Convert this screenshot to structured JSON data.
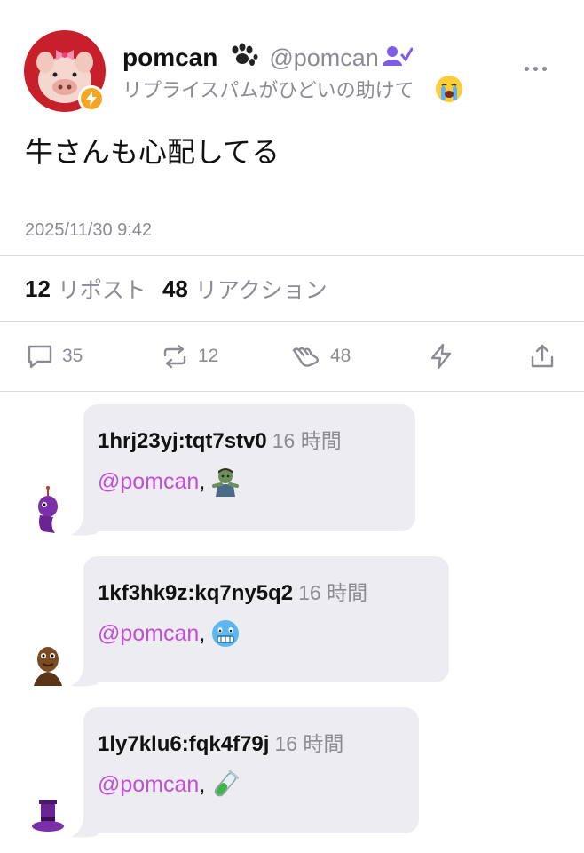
{
  "post": {
    "author": {
      "display_name": "pomcan",
      "handle": "@pomcan",
      "bio": "リプライスパムがひどいの助けて",
      "avatar_icon": "pig-avatar-icon",
      "badge_icon": "bolt-badge-icon"
    },
    "text": "牛さんも心配してる",
    "timestamp": "2025/11/30 9:42",
    "stats": {
      "reposts_count": "12",
      "reposts_label": "リポスト",
      "reactions_count": "48",
      "reactions_label": "リアクション"
    },
    "actions": {
      "reply_count": "35",
      "repost_count": "12",
      "reaction_count": "48"
    }
  },
  "replies": [
    {
      "username": "1hrj23yj:tqt7stv0",
      "time": "16 時間",
      "mention": "@pomcan",
      "separator": ",",
      "emoji": "zombie-emoji-icon"
    },
    {
      "username": "1kf3hk9z:kq7ny5q2",
      "time": "16 時間",
      "mention": "@pomcan",
      "separator": ",",
      "emoji": "cold-face-emoji-icon"
    },
    {
      "username": "1ly7klu6:fqk4f79j",
      "time": "16 時間",
      "mention": "@pomcan",
      "separator": ",",
      "emoji": "test-tube-emoji-icon"
    }
  ],
  "colors": {
    "mention": "#c24ed6",
    "muted": "#8b8b93",
    "bubble": "#ededf1",
    "badge": "#f5a623"
  }
}
